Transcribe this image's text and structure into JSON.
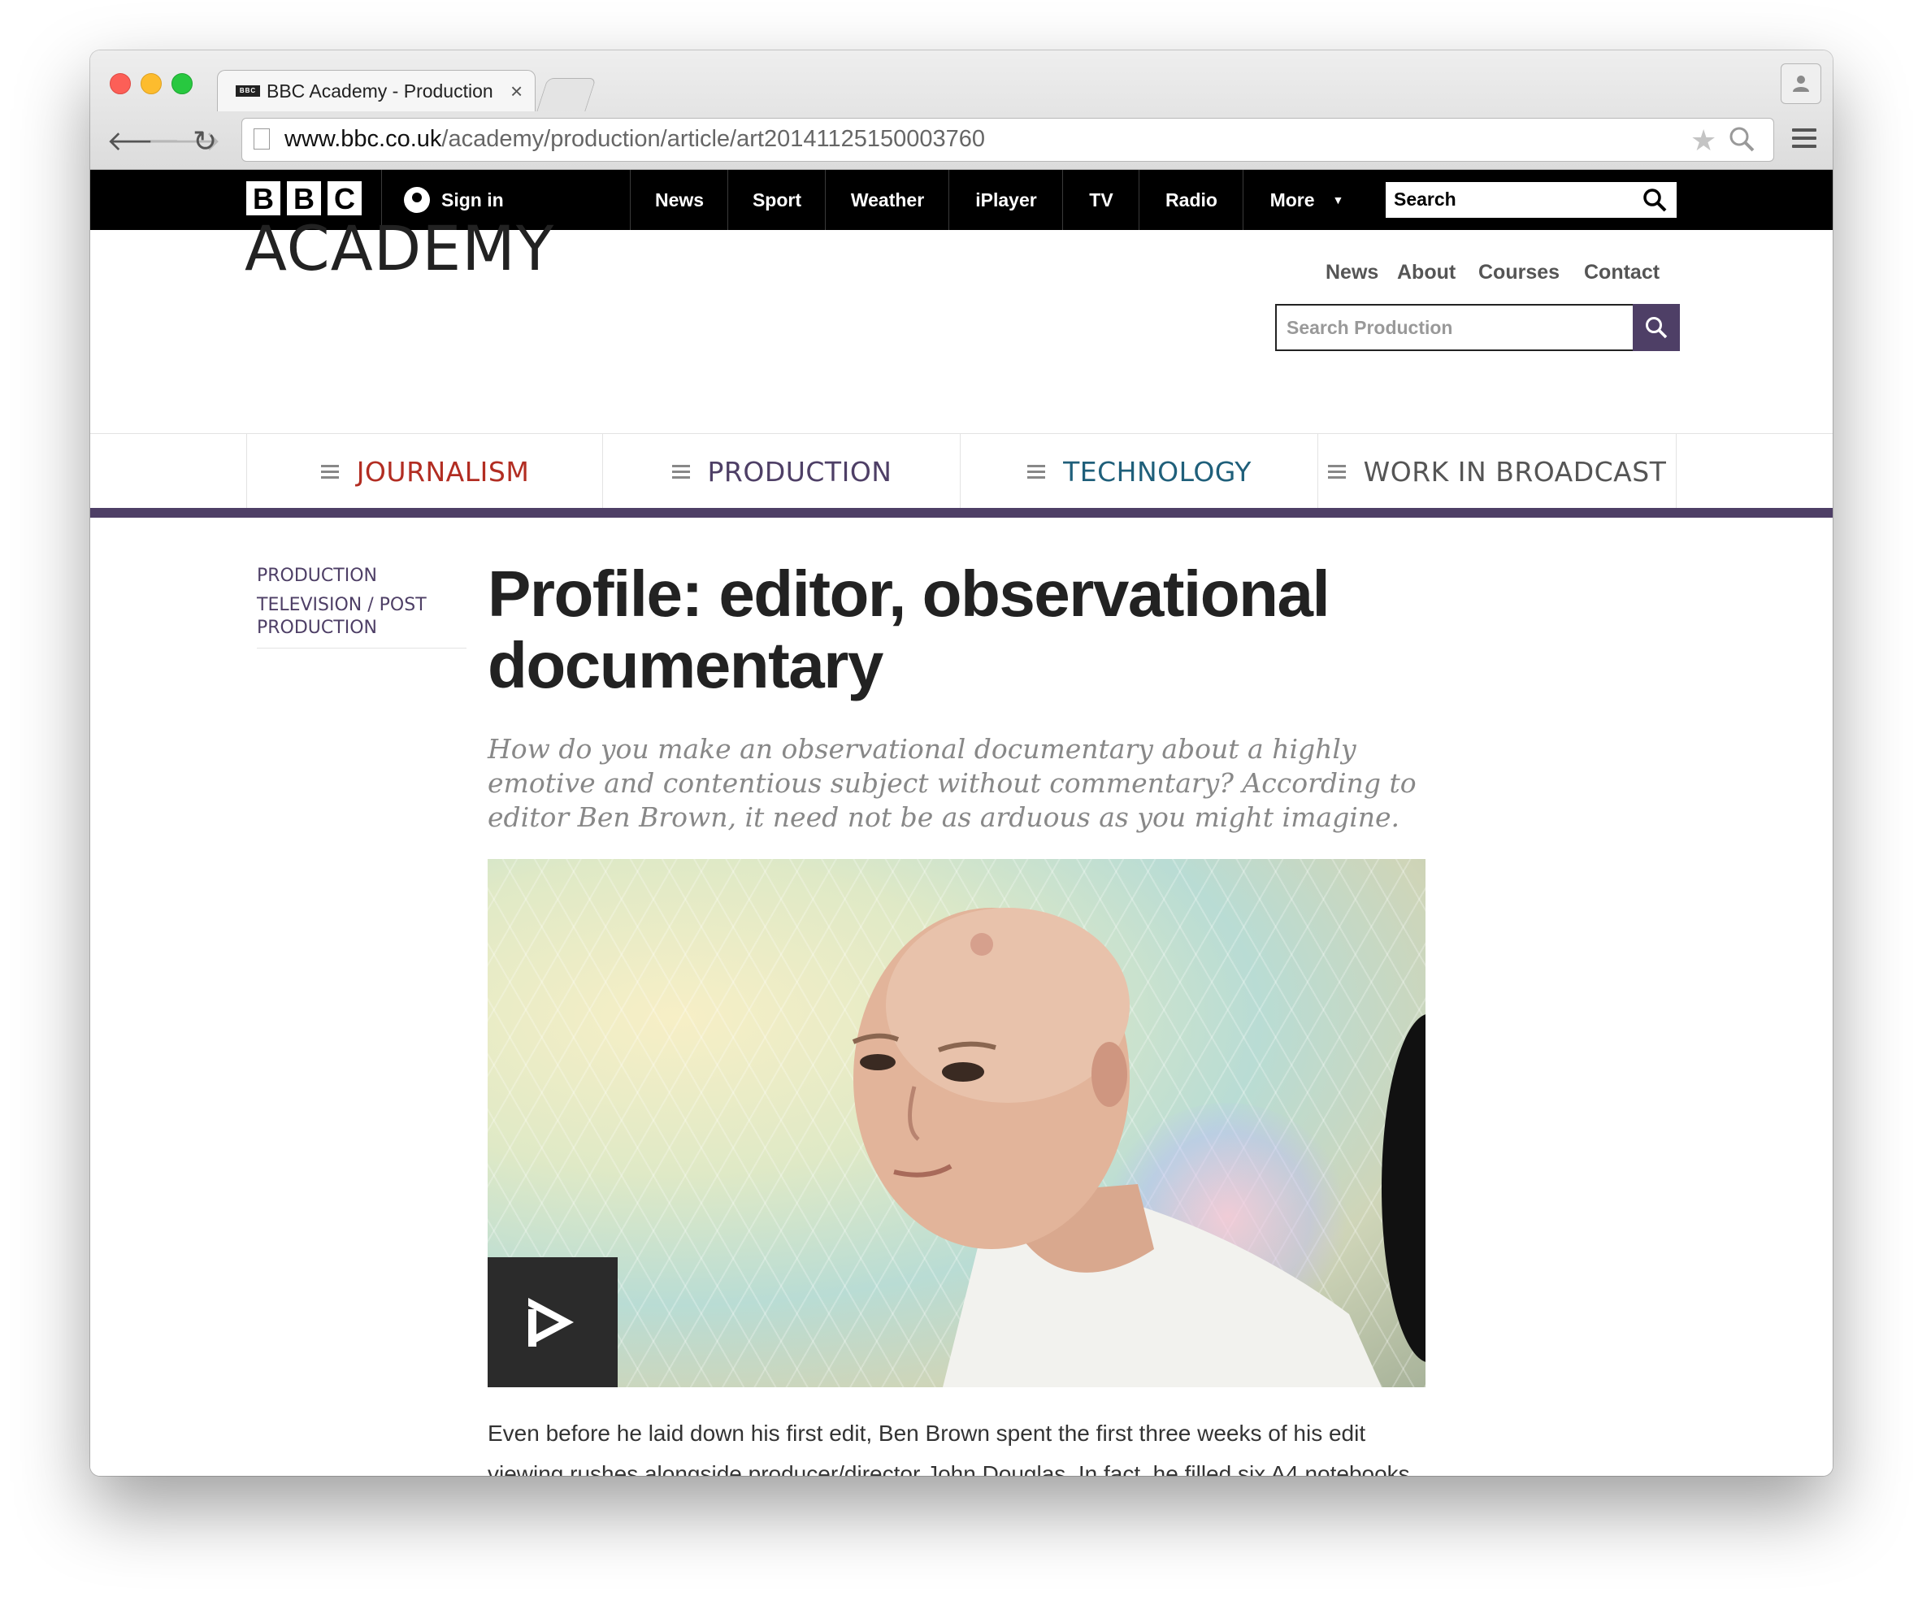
{
  "browser": {
    "tab_title": "BBC Academy - Production",
    "tab_favicon": "BBC",
    "tab_close": "×",
    "url_host": "www.bbc.co.uk",
    "url_path": "/academy/production/article/art20141125150003760"
  },
  "bbc_bar": {
    "logo_letters": [
      "B",
      "B",
      "C"
    ],
    "signin_label": "Sign in",
    "nav": [
      "News",
      "Sport",
      "Weather",
      "iPlayer",
      "TV",
      "Radio",
      "More"
    ],
    "search_placeholder": "Search"
  },
  "academy": {
    "logo": "ACADEMY",
    "util_links": [
      "News",
      "About",
      "Courses",
      "Contact"
    ],
    "search_placeholder": "Search Production",
    "sections": [
      "JOURNALISM",
      "PRODUCTION",
      "TECHNOLOGY",
      "WORK IN BROADCAST"
    ]
  },
  "article": {
    "breadcrumbs": [
      "PRODUCTION",
      "TELEVISION / POST PRODUCTION"
    ],
    "headline": "Profile: editor, observational documentary",
    "standfirst": "How do you make an observational documentary about a highly emotive and contentious subject without commentary? According to editor Ben Brown, it need not be as arduous as you might imagine.",
    "body": "Even before he laid down his first edit, Ben Brown spent the first three weeks of his edit viewing rushes alongside producer/director John Douglas. In fact, he filled six A4 notebooks with his observations on what he watched around the trial for murder of Guy"
  },
  "colors": {
    "academy_purple": "#4e3f66",
    "journalism_red": "#b22d22",
    "technology_blue": "#1f5f7a",
    "bbc_black": "#000000"
  },
  "icons": [
    "user-icon",
    "search-icon",
    "star-icon",
    "zoom-icon",
    "menu-icon",
    "play-icon",
    "hamburger-icon"
  ]
}
